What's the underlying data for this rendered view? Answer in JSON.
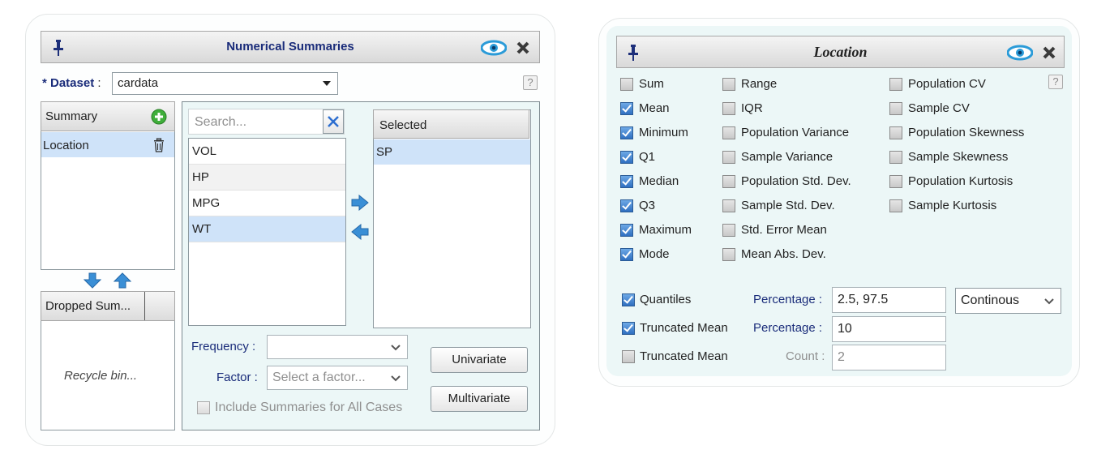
{
  "left_panel": {
    "title": "Numerical Summaries",
    "dataset_label": "* Dataset",
    "dataset_colon": ":",
    "dataset_value": "cardata",
    "help": "?",
    "summary_header": "Summary",
    "summary_items": [
      {
        "label": "Location"
      }
    ],
    "dropped_header": "Dropped Sum...",
    "recycle_text": "Recycle bin...",
    "search_placeholder": "Search...",
    "variables": [
      {
        "label": "VOL"
      },
      {
        "label": "HP"
      },
      {
        "label": "MPG"
      },
      {
        "label": "WT"
      }
    ],
    "selected_header": "Selected",
    "selected_items": [
      {
        "label": "SP"
      }
    ],
    "frequency_label": "Frequency :",
    "frequency_value": "",
    "factor_label": "Factor :",
    "factor_placeholder": "Select a factor...",
    "include_all_label": "Include Summaries for All Cases",
    "univariate_label": "Univariate",
    "multivariate_label": "Multivariate"
  },
  "right_panel": {
    "title": "Location",
    "help": "?",
    "col1": [
      {
        "label": "Sum",
        "checked": false
      },
      {
        "label": "Mean",
        "checked": true
      },
      {
        "label": "Minimum",
        "checked": true
      },
      {
        "label": "Q1",
        "checked": true
      },
      {
        "label": "Median",
        "checked": true
      },
      {
        "label": "Q3",
        "checked": true
      },
      {
        "label": "Maximum",
        "checked": true
      },
      {
        "label": "Mode",
        "checked": true
      }
    ],
    "col2": [
      {
        "label": "Range",
        "checked": false
      },
      {
        "label": "IQR",
        "checked": false
      },
      {
        "label": "Population Variance",
        "checked": false
      },
      {
        "label": "Sample Variance",
        "checked": false
      },
      {
        "label": "Population Std. Dev.",
        "checked": false
      },
      {
        "label": "Sample Std. Dev.",
        "checked": false
      },
      {
        "label": "Std. Error Mean",
        "checked": false
      },
      {
        "label": "Mean Abs. Dev.",
        "checked": false
      }
    ],
    "col3": [
      {
        "label": "Population CV",
        "checked": false
      },
      {
        "label": "Sample CV",
        "checked": false
      },
      {
        "label": "Population Skewness",
        "checked": false
      },
      {
        "label": "Sample Skewness",
        "checked": false
      },
      {
        "label": "Population Kurtosis",
        "checked": false
      },
      {
        "label": "Sample Kurtosis",
        "checked": false
      }
    ],
    "quantiles": {
      "label": "Quantiles",
      "checked": true,
      "pct_label": "Percentage :",
      "pct_value": "2.5, 97.5",
      "method": "Continous"
    },
    "trunc_pct": {
      "label": "Truncated Mean",
      "checked": true,
      "pct_label": "Percentage :",
      "pct_value": "10"
    },
    "trunc_count": {
      "label": "Truncated Mean",
      "checked": false,
      "count_label": "Count :",
      "count_value": "2"
    }
  }
}
